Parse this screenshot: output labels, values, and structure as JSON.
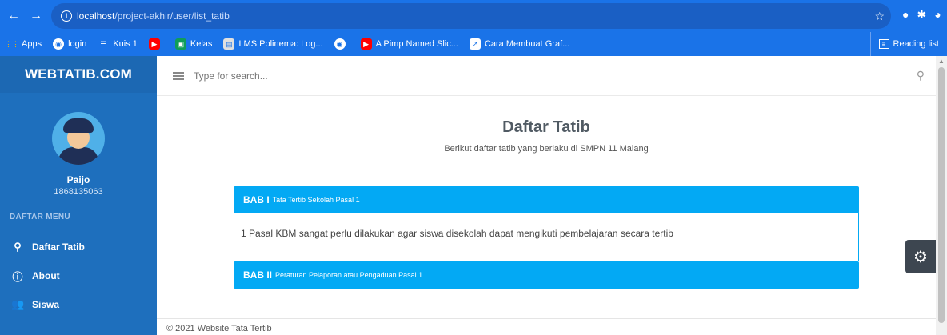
{
  "browser": {
    "url_host": "localhost",
    "url_path": "/project-akhir/user/list_tatib",
    "bookmarks": [
      {
        "label": "Apps",
        "icon": "apps-grid-icon",
        "color": "#f4b400"
      },
      {
        "label": "login",
        "icon": "globe-icon",
        "color": "#1a73e8"
      },
      {
        "label": "Kuis 1",
        "icon": "form-icon",
        "color": "#ffffff"
      },
      {
        "label": "",
        "icon": "youtube-icon",
        "color": "#ff0000"
      },
      {
        "label": "Kelas",
        "icon": "classroom-icon",
        "color": "#0f9d58"
      },
      {
        "label": "LMS Polinema: Log...",
        "icon": "lms-icon",
        "color": "#ffffff"
      },
      {
        "label": "",
        "icon": "globe-icon",
        "color": "#ffffff"
      },
      {
        "label": "A Pimp Named Slic...",
        "icon": "youtube-icon",
        "color": "#ff0000"
      },
      {
        "label": "Cara Membuat Graf...",
        "icon": "chart-icon",
        "color": "#ffffff"
      }
    ],
    "reading_list": "Reading list"
  },
  "sidebar": {
    "brand": "WEBTATIB.COM",
    "user_name": "Paijo",
    "user_id": "1868135063",
    "menu_header": "DAFTAR MENU",
    "items": [
      {
        "label": "Daftar Tatib",
        "icon": "user-icon"
      },
      {
        "label": "About",
        "icon": "info-icon"
      },
      {
        "label": "Siswa",
        "icon": "users-icon"
      }
    ]
  },
  "topbar": {
    "search_placeholder": "Type for search..."
  },
  "main": {
    "title": "Daftar Tatib",
    "subtitle": "Berikut daftar tatib yang berlaku di SMPN 11 Malang",
    "sections": [
      {
        "bab": "BAB I",
        "title": "Tata Tertib Sekolah Pasal 1",
        "body": "1 Pasal KBM sangat perlu dilakukan agar siswa disekolah dapat mengikuti pembelajaran secara tertib"
      },
      {
        "bab": "BAB II",
        "title": "Peraturan Pelaporan atau Pengaduan Pasal 1"
      }
    ]
  },
  "footer": {
    "text": "© 2021 Website Tata Tertib"
  },
  "colors": {
    "sidebar": "#1e6fbd",
    "accent": "#03a9f4",
    "browser": "#1a73e8"
  }
}
